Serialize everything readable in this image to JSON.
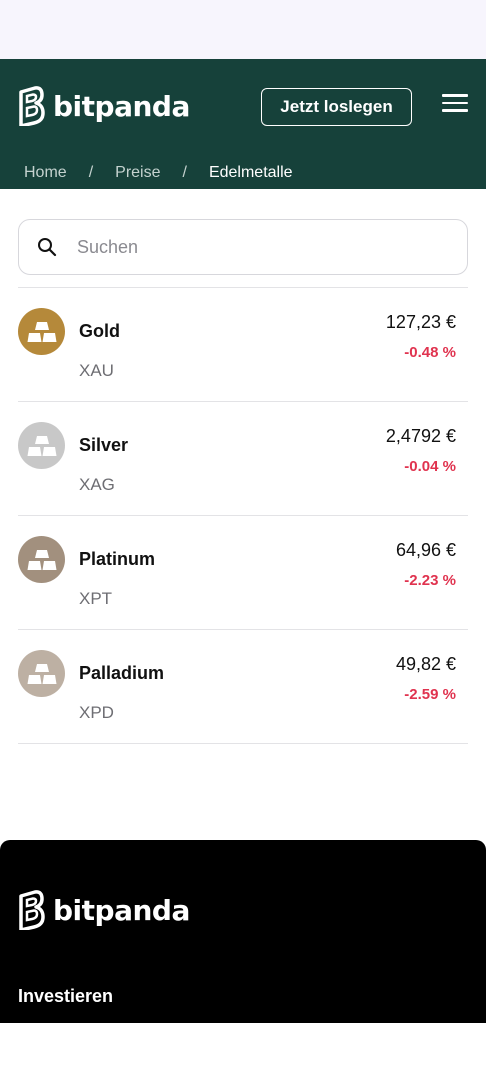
{
  "header": {
    "brand": "bitpanda",
    "cta_label": "Jetzt loslegen"
  },
  "breadcrumb": {
    "items": [
      "Home",
      "Preise",
      "Edelmetalle"
    ],
    "separator": "/"
  },
  "search": {
    "placeholder": "Suchen"
  },
  "metals": [
    {
      "name": "Gold",
      "symbol": "XAU",
      "price": "127,23 €",
      "change": "-0.48 %",
      "color": "#b5893a"
    },
    {
      "name": "Silver",
      "symbol": "XAG",
      "price": "2,4792 €",
      "change": "-0.04 %",
      "color": "#c8c8c8"
    },
    {
      "name": "Platinum",
      "symbol": "XPT",
      "price": "64,96 €",
      "change": "-2.23 %",
      "color": "#a2907e"
    },
    {
      "name": "Palladium",
      "symbol": "XPD",
      "price": "49,82 €",
      "change": "-2.59 %",
      "color": "#bdb0a3"
    }
  ],
  "footer": {
    "brand": "bitpanda",
    "section_label": "Investieren"
  },
  "colors": {
    "header_bg": "#16413a",
    "negative": "#e0334f",
    "footer_bg": "#000000"
  }
}
